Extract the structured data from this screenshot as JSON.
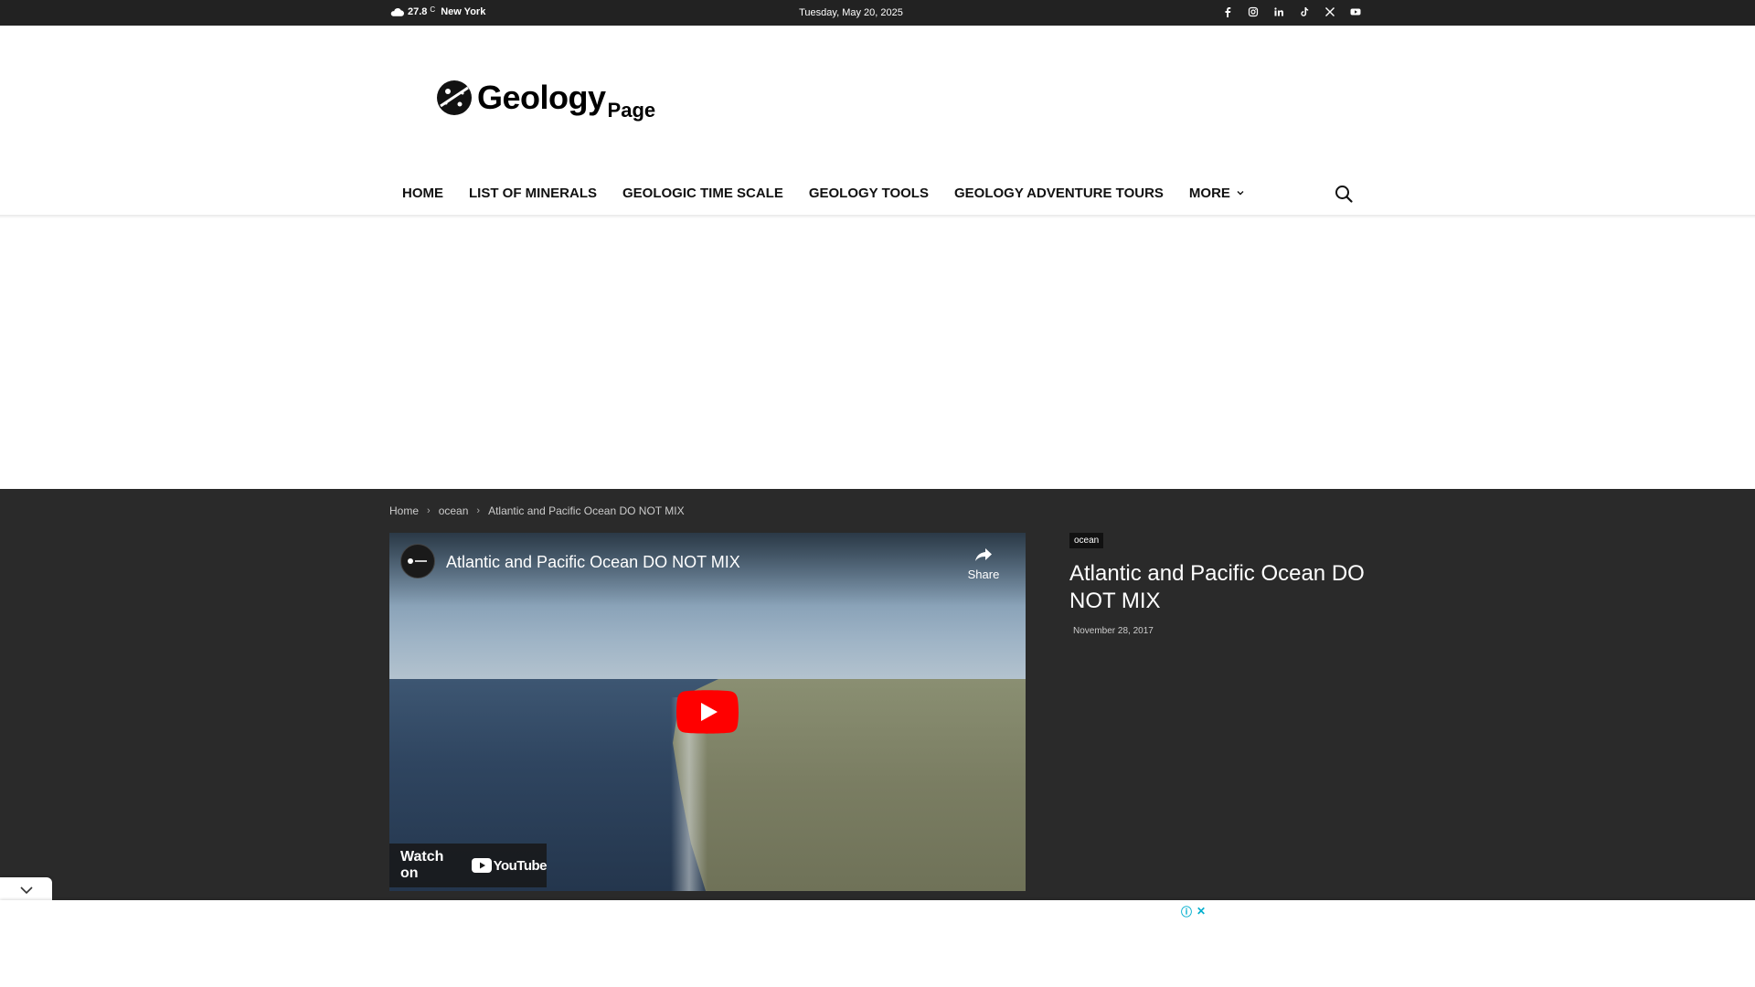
{
  "topbar": {
    "temperature": "27.8",
    "degree_unit": "C",
    "city": "New York",
    "date": "Tuesday, May 20, 2025",
    "socials": [
      "facebook",
      "instagram",
      "linkedin",
      "tiktok",
      "x",
      "youtube"
    ]
  },
  "logo": {
    "main": "Geology",
    "sub": "Page"
  },
  "nav": {
    "items": [
      {
        "label": "HOME"
      },
      {
        "label": "LIST OF MINERALS"
      },
      {
        "label": "GEOLOGIC TIME SCALE"
      },
      {
        "label": "GEOLOGY TOOLS"
      },
      {
        "label": "GEOLOGY ADVENTURE TOURS"
      },
      {
        "label": "MORE"
      }
    ]
  },
  "breadcrumb": [
    "Home",
    "ocean",
    "Atlantic and Pacific Ocean DO NOT MIX"
  ],
  "video": {
    "title": "Atlantic and Pacific Ocean DO NOT MIX",
    "share_label": "Share",
    "watch_on_label": "Watch on",
    "youtube_label": "YouTube"
  },
  "article": {
    "category": "ocean",
    "title": "Atlantic and Pacific Ocean DO NOT MIX",
    "date": "November 28, 2017"
  },
  "colors": {
    "topbar_bg": "#222222",
    "dark_section_bg": "#2a2a2a",
    "youtube_red": "#ff0000",
    "ad_icon": "#00aecd"
  }
}
